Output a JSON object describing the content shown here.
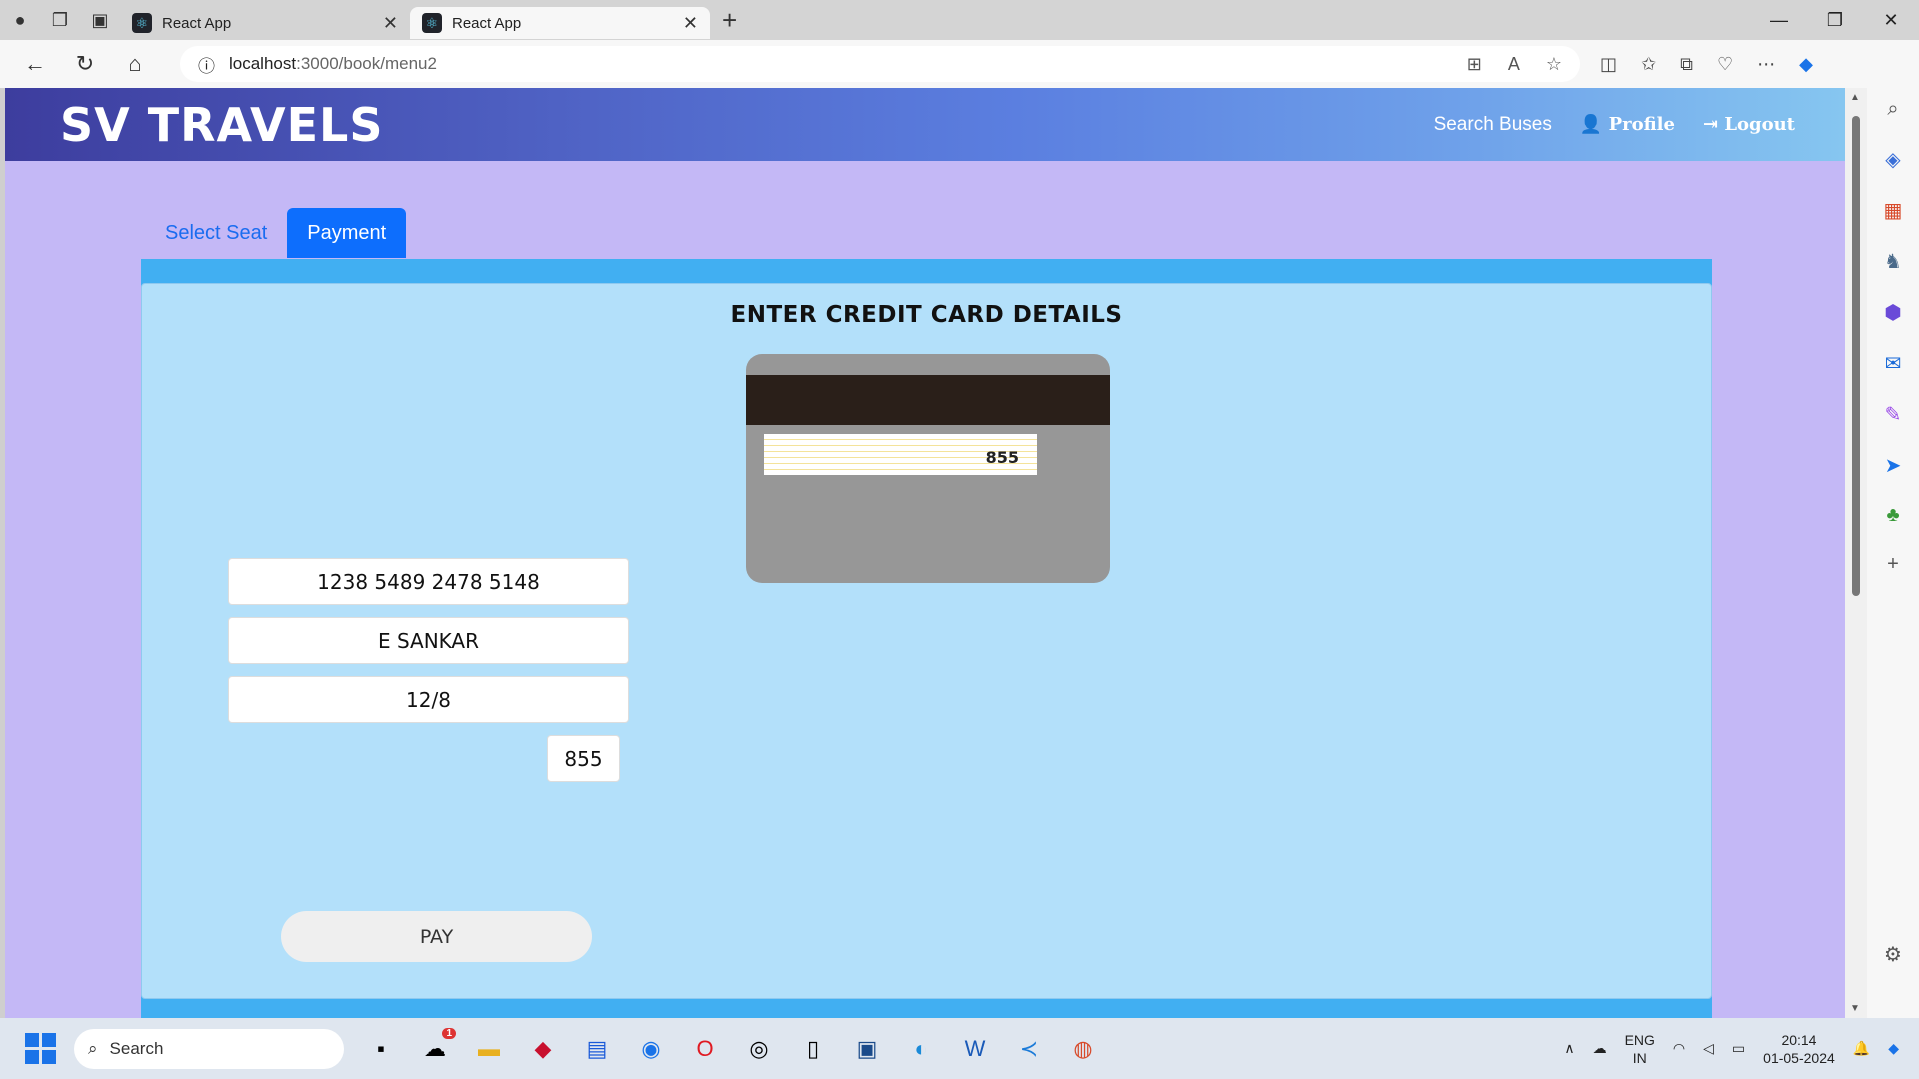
{
  "browser": {
    "tabs": [
      {
        "title": "React App",
        "active": false
      },
      {
        "title": "React App",
        "active": true
      }
    ],
    "url_host": "localhost",
    "url_path": ":3000/book/menu2"
  },
  "header": {
    "brand": "SV TRAVELS",
    "nav": {
      "search_buses": "Search Buses",
      "profile": "Profile",
      "logout": "Logout"
    }
  },
  "steps": {
    "select_seat": "Select Seat",
    "payment": "Payment"
  },
  "form": {
    "title": "ENTER CREDIT CARD DETAILS",
    "card_preview_cvv": "855",
    "card_number": "1238 5489 2478 5148",
    "card_name": "E SANKAR",
    "expiry": "12/8",
    "cvv": "855",
    "pay_label": "PAY"
  },
  "taskbar": {
    "search_label": "Search",
    "lang_top": "ENG",
    "lang_bottom": "IN",
    "time": "20:14",
    "date": "01-05-2024",
    "notification_badge": "1"
  }
}
